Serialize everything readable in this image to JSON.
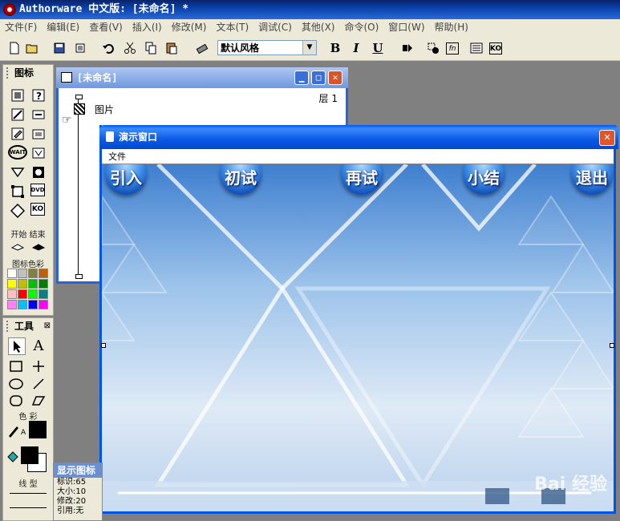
{
  "app": {
    "title": "Authorware 中文版: [未命名] *"
  },
  "menu": [
    "文件(F)",
    "编辑(E)",
    "查看(V)",
    "插入(I)",
    "修改(M)",
    "文本(T)",
    "调试(C)",
    "其他(X)",
    "命令(O)",
    "窗口(W)",
    "帮助(H)"
  ],
  "toolbar": {
    "style_select": "默认风格",
    "bold": "B",
    "italic": "I",
    "underline": "U",
    "fn_label": "fn",
    "ko_label": "KO"
  },
  "icons_palette": {
    "title": "图标",
    "wait_label": "WAIT",
    "dvd_label": "DVD",
    "ko_label": "KO",
    "start_end_label": "开始 结束",
    "icon_color_label": "图标色彩",
    "swatches": [
      "#ffffff",
      "#c0c0c0",
      "#808040",
      "#c06000",
      "#ffff00",
      "#c0c000",
      "#00c000",
      "#008000",
      "#ffc0c0",
      "#ff0000",
      "#00ff00",
      "#008080",
      "#ff80ff",
      "#00c0ff",
      "#0000ff",
      "#ff00ff"
    ]
  },
  "tools_palette": {
    "title": "工具",
    "text_tool": "A",
    "color_label": "色 彩",
    "line_label": "线 型",
    "fill_label": "A"
  },
  "flow_window": {
    "title": "[未命名]",
    "level": "层 1",
    "icon_label": "图片"
  },
  "presentation_window": {
    "title": "演示窗口",
    "menu_file": "文件",
    "buttons": [
      "引入",
      "初试",
      "再试",
      "小结",
      "退出"
    ]
  },
  "properties": {
    "title": "显示图标",
    "id_label": "标识:65",
    "size_label": "大小:10",
    "modified_label": "修改:20",
    "ref_label": "引用:无"
  },
  "watermark": "Bai 经验"
}
